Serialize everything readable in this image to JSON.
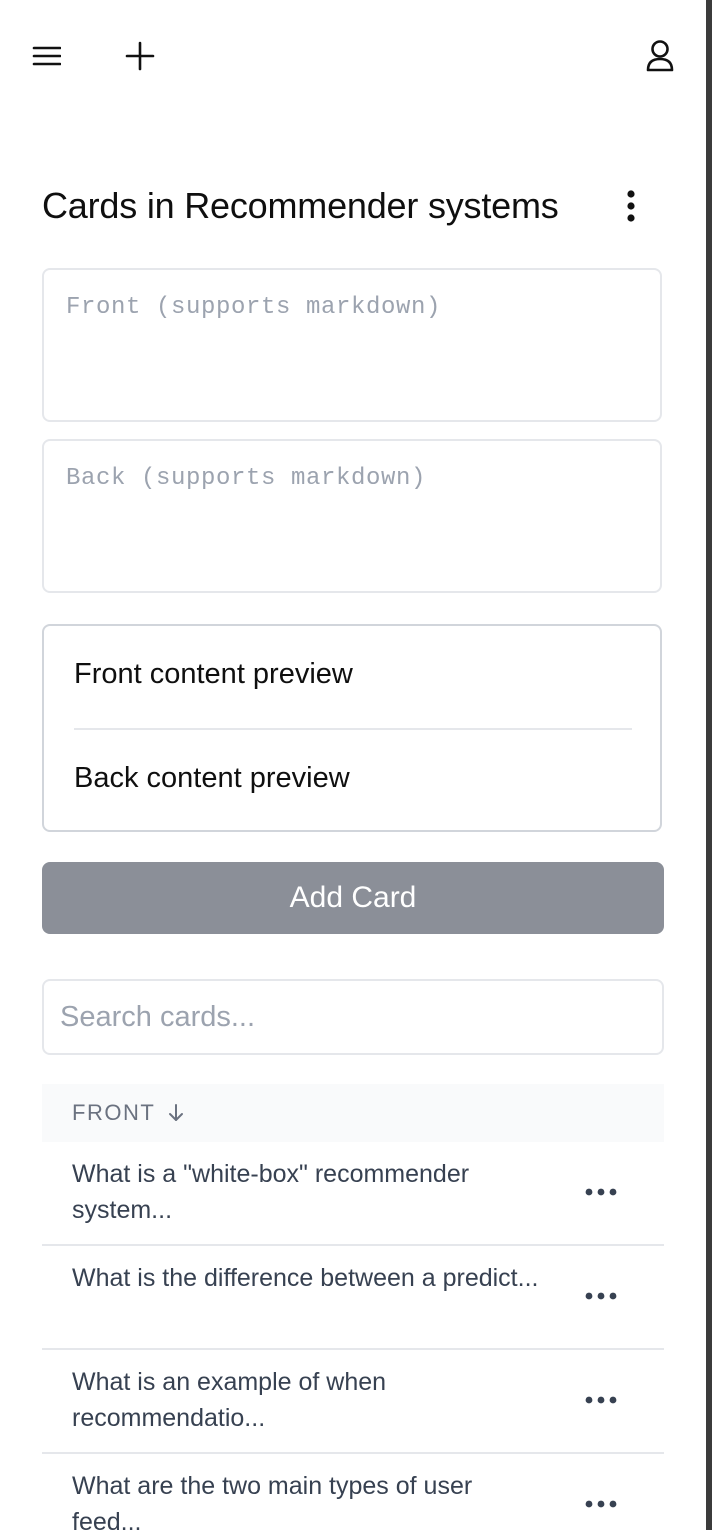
{
  "header": {
    "menu_icon": "hamburger-menu-icon",
    "new_icon": "plus-icon",
    "user_icon": "user-icon"
  },
  "page": {
    "title": "Cards in Recommender systems",
    "options_icon": "vertical-dots-icon"
  },
  "editor": {
    "front_placeholder": "Front (supports markdown)",
    "back_placeholder": "Back (supports markdown)",
    "front_value": "",
    "back_value": ""
  },
  "preview": {
    "front_text": "Front content preview",
    "back_text": "Back content preview"
  },
  "actions": {
    "add_card_label": "Add Card",
    "add_card_color": "#8b8f98"
  },
  "search": {
    "placeholder": "Search cards...",
    "value": ""
  },
  "table": {
    "column_header": "FRONT",
    "sort_icon": "arrow-down-icon",
    "rows": [
      {
        "front": "What is a \"white-box\" recommender system..."
      },
      {
        "front": "What is the difference between a predict..."
      },
      {
        "front": "What is an example of when recommendatio..."
      },
      {
        "front": "What are the two main types of user feed..."
      }
    ],
    "row_menu_icon": "horizontal-dots-icon"
  }
}
